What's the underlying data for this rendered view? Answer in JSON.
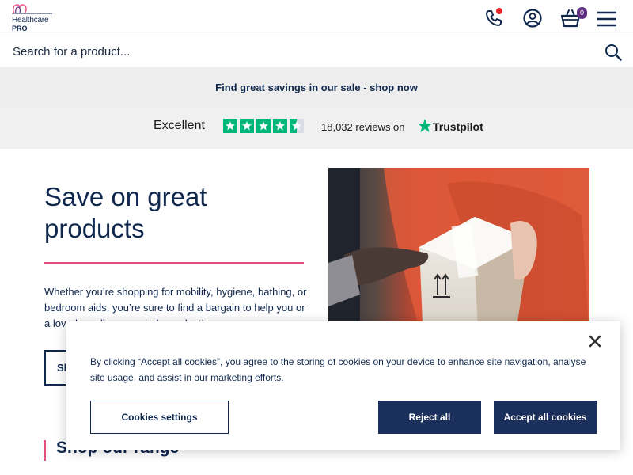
{
  "header": {
    "logo_line1": "Healthcare",
    "logo_line2": "PRO",
    "basket_count": "0",
    "icons": [
      "phone-icon",
      "account-icon",
      "basket-icon",
      "menu-icon"
    ],
    "notification_color": "#e8242b",
    "badge_color": "#5a2d82"
  },
  "search": {
    "placeholder": "Search for a product..."
  },
  "promo": {
    "text": "Find great savings in our sale - shop now"
  },
  "trustpilot": {
    "rating_word": "Excellent",
    "stars": 4.5,
    "reviews_text": "18,032 reviews on",
    "brand": "Trustpilot",
    "star_color": "#00b67a"
  },
  "hero": {
    "title": "Save on great products",
    "body": "Whether you’re shopping for mobility, hygiene, bathing, or bedroom aids, you’re sure to find a bargain to help you or a loved one live more independently.",
    "button_label": "Shop now",
    "accent_color": "#e0507a"
  },
  "range": {
    "title": "Shop our range"
  },
  "cookie_banner": {
    "text": "By clicking “Accept all cookies”, you agree to the storing of cookies on your device to enhance site navigation, analyse site usage, and assist in our marketing efforts.",
    "settings_label": "Cookies settings",
    "reject_label": "Reject all",
    "accept_label": "Accept all cookies",
    "button_color": "#1b2f5c"
  }
}
